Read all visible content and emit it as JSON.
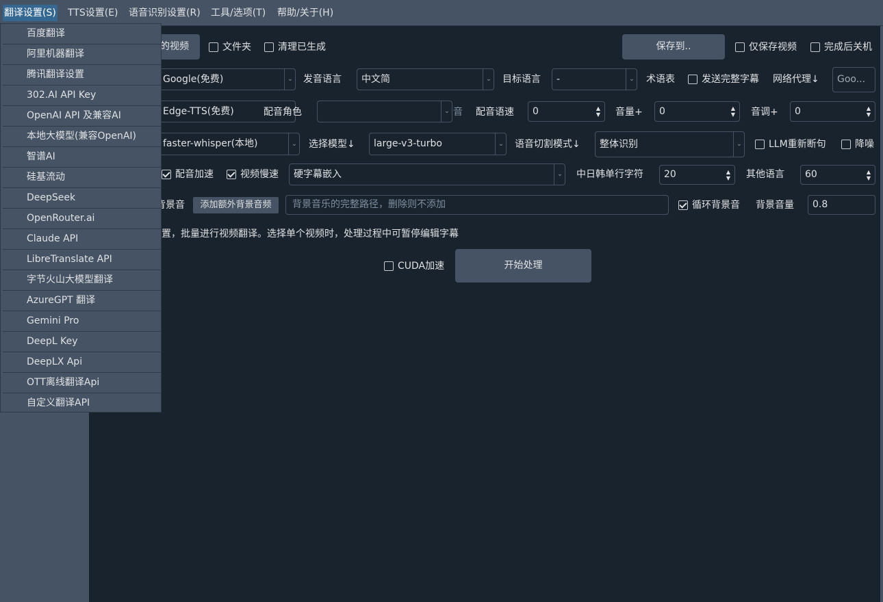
{
  "menubar": {
    "items": [
      {
        "label": "翻译设置(S)",
        "active": true
      },
      {
        "label": "TTS设置(E)"
      },
      {
        "label": "语音识别设置(R)"
      },
      {
        "label": "工具/选项(T)"
      },
      {
        "label": "帮助/关于(H)"
      }
    ]
  },
  "dropdown": {
    "items": [
      "百度翻译",
      "阿里机器翻译",
      "腾讯翻译设置",
      "302.AI API Key",
      "OpenAI API 及兼容AI",
      "本地大模型(兼容OpenAI)",
      "智谱AI",
      "硅基流动",
      "DeepSeek",
      "OpenRouter.ai",
      "Claude API",
      "LibreTranslate API",
      "字节火山大模型翻译",
      "AzureGPT 翻译",
      "Gemini Pro",
      "DeepL Key",
      "DeepLX Api",
      "OTT离线翻译Api",
      "自定义翻译API"
    ]
  },
  "row1": {
    "select_video_label": "的视频",
    "folder_label": "文件夹",
    "clean_label": "清理已生成",
    "save_to_label": "保存到..",
    "only_save_video_label": "仅保存视频",
    "shutdown_label": "完成后关机"
  },
  "row2": {
    "translator_value": "Google(免费)",
    "source_lang_label": "发音语言",
    "source_lang_value": "中文简",
    "target_lang_label": "目标语言",
    "target_lang_value": "-",
    "glossary_label": "术语表",
    "send_full_label": "发送完整字幕",
    "proxy_label": "网络代理↓",
    "proxy_placeholder": "Goo..."
  },
  "row3": {
    "tts_value": "Edge-TTS(免费)",
    "voice_role_label": "配音角色",
    "voice_role_value": "",
    "tts_speed_label": "配音语速",
    "tts_speed_value": "0",
    "volume_label": "音量+",
    "volume_value": "0",
    "pitch_label": "音调+",
    "pitch_value": "0",
    "clipped_label": "音"
  },
  "row4": {
    "asr_value": "faster-whisper(本地)",
    "model_label": "选择模型↓",
    "model_value": "large-v3-turbo",
    "split_mode_label": "语音切割模式↓",
    "split_mode_value": "整体识别",
    "llm_resegment_label": "LLM重新断句",
    "denoise_label": "降噪"
  },
  "row5": {
    "dub_speedup_label": "配音加速",
    "video_slow_label": "视频慢速",
    "subtitle_mode_value": "硬字幕嵌入",
    "cjk_chars_label": "中日韩单行字符",
    "cjk_chars_value": "20",
    "other_lang_label": "其他语言",
    "other_lang_value": "60"
  },
  "row6": {
    "bgm_label": "背景音",
    "add_bgm_label": "添加额外背景音频",
    "bgm_path_placeholder": "背景音乐的完整路径，删除则不添加",
    "loop_bgm_label": "循环背景音",
    "bgm_volume_label": "背景音量",
    "bgm_volume_value": "0.8"
  },
  "hint": {
    "text": "置，批量进行视频翻译。选择单个视频时，处理过程中可暂停编辑字幕"
  },
  "actions": {
    "cuda_label": "CUDA加速",
    "start_label": "开始处理"
  },
  "colors": {
    "background": "#19232d",
    "panel": "#455364",
    "highlight": "#346792",
    "text": "#e0e1e3"
  }
}
